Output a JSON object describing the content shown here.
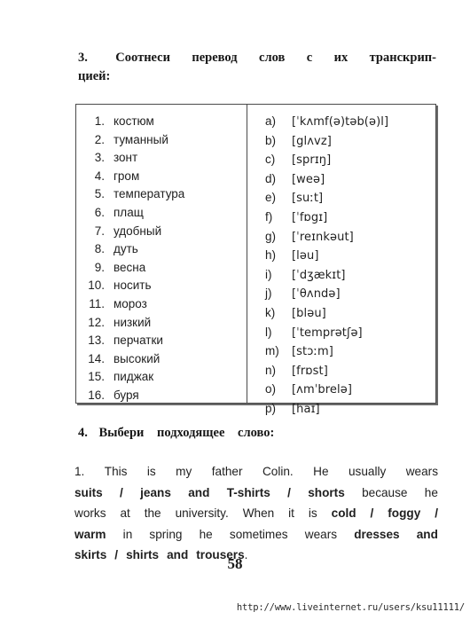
{
  "task3": {
    "number": "3.",
    "line1_words": [
      "Соотнеси",
      "перевод",
      "слов",
      "с",
      "их",
      "транскрип-"
    ],
    "line2": "цией:",
    "words": [
      {
        "marker": "1.",
        "text": "костюм"
      },
      {
        "marker": "2.",
        "text": "туманный"
      },
      {
        "marker": "3.",
        "text": "зонт"
      },
      {
        "marker": "4.",
        "text": "гром"
      },
      {
        "marker": "5.",
        "text": "температура"
      },
      {
        "marker": "6.",
        "text": "плащ"
      },
      {
        "marker": "7.",
        "text": "удобный"
      },
      {
        "marker": "8.",
        "text": "дуть"
      },
      {
        "marker": "9.",
        "text": "весна"
      },
      {
        "marker": "10.",
        "text": "носить"
      },
      {
        "marker": "11.",
        "text": "мороз"
      },
      {
        "marker": "12.",
        "text": "низкий"
      },
      {
        "marker": "13.",
        "text": "перчатки"
      },
      {
        "marker": "14.",
        "text": "высокий"
      },
      {
        "marker": "15.",
        "text": "пиджак"
      },
      {
        "marker": "16.",
        "text": "буря"
      }
    ],
    "transcriptions": [
      {
        "marker": "a)",
        "text": "[ˈkʌmf(ə)təb(ə)l]"
      },
      {
        "marker": "b)",
        "text": "[glʌvz]"
      },
      {
        "marker": "c)",
        "text": "[sprɪŋ]"
      },
      {
        "marker": "d)",
        "text": "[weə]"
      },
      {
        "marker": "e)",
        "text": "[suːt]"
      },
      {
        "marker": "f)",
        "text": "[ˈfɒgɪ]"
      },
      {
        "marker": "g)",
        "text": "[ˈreɪnkəut]"
      },
      {
        "marker": "h)",
        "text": "[ləu]"
      },
      {
        "marker": "i)",
        "text": "[ˈdʒækɪt]"
      },
      {
        "marker": "j)",
        "text": "[ˈθʌndə]"
      },
      {
        "marker": "k)",
        "text": "[bləu]"
      },
      {
        "marker": "l)",
        "text": "[ˈtemprətʃə]"
      },
      {
        "marker": "m)",
        "text": "[stɔːm]"
      },
      {
        "marker": "n)",
        "text": "[frɒst]"
      },
      {
        "marker": "o)",
        "text": "[ʌmˈbrelə]"
      },
      {
        "marker": "p)",
        "text": "[haɪ]"
      }
    ]
  },
  "task4": {
    "number": "4.",
    "word1": "Выбери",
    "word2": "подходящее",
    "word3": "слово:",
    "exercise": {
      "line1": [
        "1.",
        "This",
        "is",
        "my",
        "father",
        "Colin.",
        "He",
        "usually",
        "wears"
      ],
      "line2": [
        "suits",
        "/",
        "jeans",
        "and",
        "T-shirts",
        "/",
        "shorts",
        "because",
        "he"
      ],
      "line3": [
        "works",
        "at",
        "the",
        "university.",
        "When",
        "it",
        "is",
        "cold",
        "/",
        "foggy",
        "/"
      ],
      "line4": [
        "warm",
        "in",
        "spring",
        "he",
        "sometimes",
        "wears",
        "dresses",
        "and"
      ],
      "line5": [
        "skirts",
        "/",
        "shirts",
        "and",
        "trousers",
        "."
      ]
    }
  },
  "page_number": "58",
  "footer_url": "http://www.liveinternet.ru/users/ksu11111/"
}
